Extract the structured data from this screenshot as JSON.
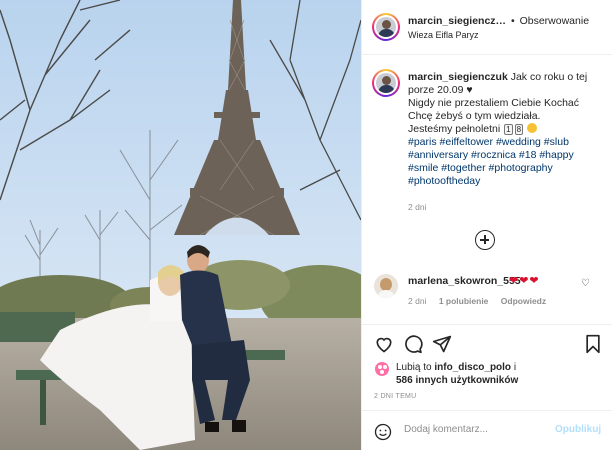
{
  "post": {
    "author": "marcin_siegienczuk",
    "author_header_truncated": "marcin_siegiencz…",
    "dot": "•",
    "follow_label": "Obserwowanie",
    "location": "Wieza Eifla Paryz",
    "image_alt": "Para młodych na ławce przed Wieżą Eiffla",
    "caption": {
      "line1": "Jak co roku o tej porze 20.09",
      "heart": "♥",
      "line2": "Nigdy nie przestaliem Ciebie Kochać Chcę żebyś o tym wiedziała.",
      "line3": "Jesteśmy pełnoletni",
      "num1": "1",
      "num2": "8",
      "hashtags": "#paris #eiffeltower #wedding #slub #anniversary #rocznica #18 #happy #smile #together #photography #photooftheday"
    },
    "caption_time": "2 dni"
  },
  "comment": {
    "user": "marlena_skowron_555",
    "text": "❤❤❤",
    "like_icon": "♡",
    "time": "2 dni",
    "likes": "1 polubienie",
    "reply": "Odpowiedz"
  },
  "likes": {
    "prefix": "Lubią to",
    "user": "info_disco_polo",
    "joiner": "i",
    "others": "586 innych użytkowników"
  },
  "time_ago": "2 DNI TEMU",
  "composer": {
    "placeholder": "Dodaj komentarz...",
    "publish": "Opublikuj"
  },
  "icons": [
    "heart-icon",
    "comment-icon",
    "share-icon",
    "bookmark-icon",
    "smile-icon",
    "load-more-icon"
  ]
}
